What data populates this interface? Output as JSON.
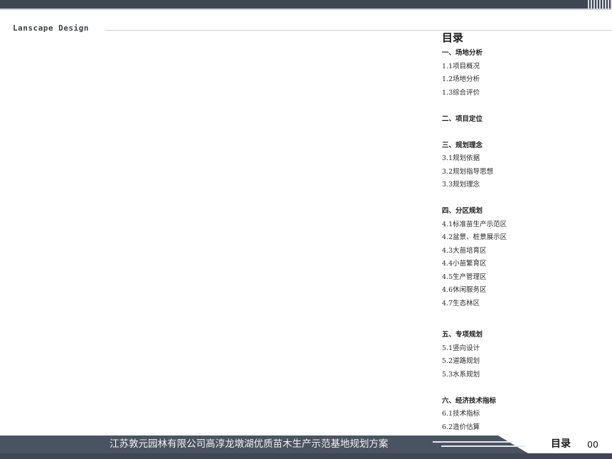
{
  "header": {
    "brand": "Lanscape Design"
  },
  "toc": {
    "title": "目录",
    "sections": [
      {
        "heading": "一、场地分析",
        "items": [
          "1.1项目概况",
          "1.2场地分析",
          "1.3综合评价"
        ]
      },
      {
        "heading": "二、项目定位",
        "items": []
      },
      {
        "heading": "三、规划理念",
        "items": [
          "3.1规划依据",
          "3.2规划指导思想",
          "3.3规划理念"
        ]
      },
      {
        "heading": "四、分区规划",
        "items": [
          "4.1标准苗生产示范区",
          "4.2盆景、桩景展示区",
          "4.3大苗培育区",
          "4.4小苗繁育区",
          "4.5生产管理区",
          "4.6休闲服务区",
          "4.7生态林区"
        ]
      },
      {
        "heading": "五、专项规划",
        "items": [
          "5.1竖向设计",
          "5.2道路规划",
          "5.3水系规划"
        ]
      },
      {
        "heading": "六、经济技术指标",
        "items": [
          "6.1技术指标",
          "6.2造价估算"
        ]
      }
    ]
  },
  "footer": {
    "project_title": "江苏敦元园林有限公司高淳龙墩湖优质苗木生产示范基地规划方案",
    "label": "目录",
    "page": "00"
  },
  "colors": {
    "bar": "#4a5361",
    "bar_dark": "#3f4654"
  }
}
